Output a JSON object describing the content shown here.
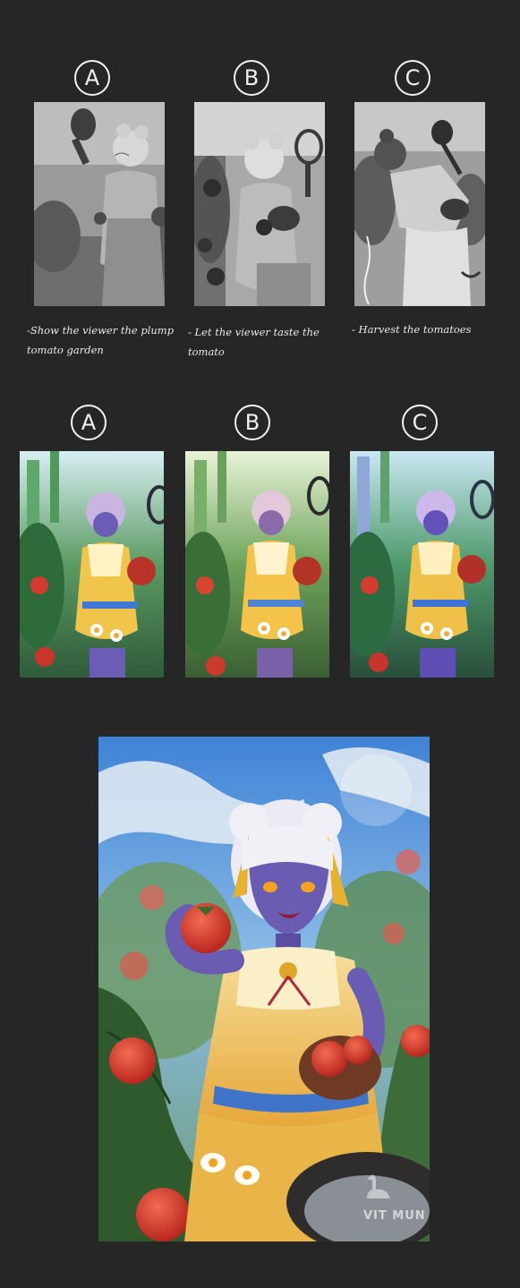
{
  "sketch_row": {
    "labels": [
      "A",
      "B",
      "C"
    ],
    "notes": [
      "-Show the viewer the plump\ntomato garden",
      "- Let the viewer taste the\ntomato",
      "- Harvest the tomatoes"
    ]
  },
  "color_row": {
    "labels": [
      "A",
      "B",
      "C"
    ]
  },
  "final": {
    "watermark": "VIT MUN"
  },
  "colors": {
    "background": "#262626",
    "ink": "#f2f2f2",
    "sky": "#4f8fd8",
    "tomato": "#d8382c",
    "dress": "#f0c24a",
    "skin": "#6a5bb3"
  }
}
